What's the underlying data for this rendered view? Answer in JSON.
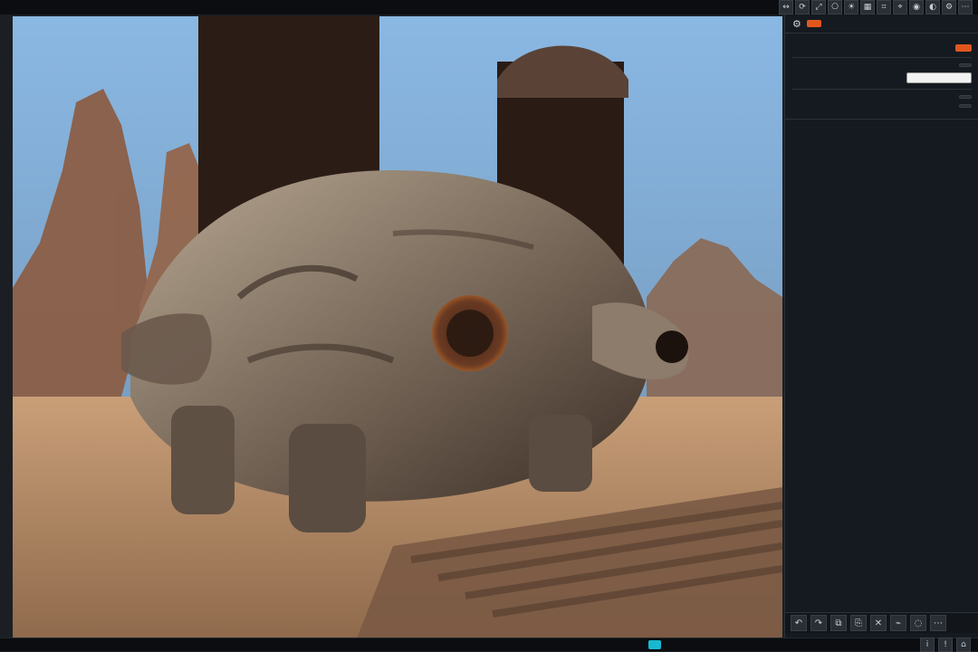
{
  "toolbar": {
    "icons": [
      {
        "name": "move-icon",
        "glyph": "↔"
      },
      {
        "name": "rotate-icon",
        "glyph": "⟳"
      },
      {
        "name": "scale-icon",
        "glyph": "⤢"
      },
      {
        "name": "camera-icon",
        "glyph": "⎔"
      },
      {
        "name": "light-icon",
        "glyph": "☀"
      },
      {
        "name": "mesh-icon",
        "glyph": "▦"
      },
      {
        "name": "grid-icon",
        "glyph": "⌗"
      },
      {
        "name": "snap-icon",
        "glyph": "⌖"
      },
      {
        "name": "render-icon",
        "glyph": "◉"
      },
      {
        "name": "material-icon",
        "glyph": "◐"
      },
      {
        "name": "settings-icon",
        "glyph": "⚙"
      },
      {
        "name": "more-icon",
        "glyph": "⋯"
      }
    ]
  },
  "panel": {
    "header": {
      "title": "",
      "icon": "gear-icon"
    },
    "sections": [
      {
        "name": "section-1",
        "rows": [
          {
            "label": "",
            "value": "",
            "type": "chip"
          }
        ]
      }
    ]
  },
  "colors": {
    "accent": "#e0571e",
    "panel_bg": "#151a20",
    "topbar_bg": "#0b0d10",
    "status_cyan": "#17b9d1"
  }
}
